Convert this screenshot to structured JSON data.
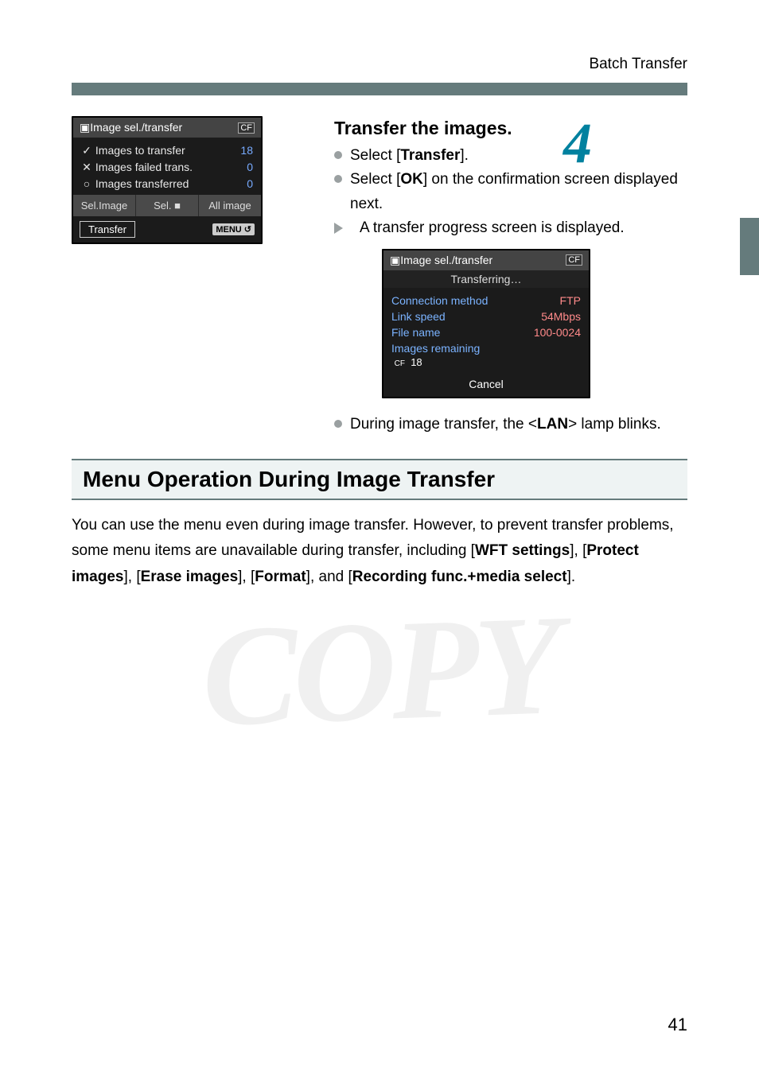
{
  "header": "Batch Transfer",
  "step": {
    "number": "4",
    "title": "Transfer the images.",
    "bullets": [
      {
        "type": "dot",
        "pre": "Select [",
        "bold": "Transfer",
        "post": "]."
      },
      {
        "type": "dot",
        "pre": "Select [",
        "bold": "OK",
        "post": "] on the confirmation screen displayed next."
      },
      {
        "type": "tri",
        "pre": "A transfer progress screen is displayed.",
        "bold": "",
        "post": ""
      }
    ],
    "afterImage": {
      "pre": "During image transfer, the <",
      "bold": "LAN",
      "post": "> lamp blinks."
    }
  },
  "screen1": {
    "title": "Image sel./transfer",
    "titleIcon": "CF",
    "rows": [
      {
        "mark": "✓",
        "label": "Images to transfer",
        "value": "18"
      },
      {
        "mark": "✕",
        "label": "Images failed trans.",
        "value": "0"
      },
      {
        "mark": "○",
        "label": "Images transferred",
        "value": "0"
      }
    ],
    "tabs": [
      "Sel.Image",
      "Sel. ■",
      "All image"
    ],
    "bottomButton": "Transfer",
    "bottomMenu": "MENU ↺"
  },
  "screen2": {
    "title": "Image sel./transfer",
    "titleIcon": "CF",
    "status": "Transferring…",
    "rows": [
      {
        "label": "Connection method",
        "value": "FTP"
      },
      {
        "label": "Link speed",
        "value": "54Mbps"
      },
      {
        "label": "File name",
        "value": "100-0024"
      },
      {
        "label": "Images remaining",
        "value": ""
      }
    ],
    "remainIcon": "CF",
    "remainValue": "18",
    "cancel": "Cancel"
  },
  "section": {
    "title": "Menu Operation During Image Transfer",
    "para1": "You can use the menu even during image transfer. However, to prevent transfer problems, some menu items are unavailable during transfer, including [",
    "b1": "WFT settings",
    "t2": "], [",
    "b2": "Protect images",
    "t3": "], [",
    "b3": "Erase images",
    "t4": "], [",
    "b4": "Format",
    "t5": "], and [",
    "b5": "Recording func.+media select",
    "t6": "]."
  },
  "watermark": "COPY",
  "pageNumber": "41"
}
